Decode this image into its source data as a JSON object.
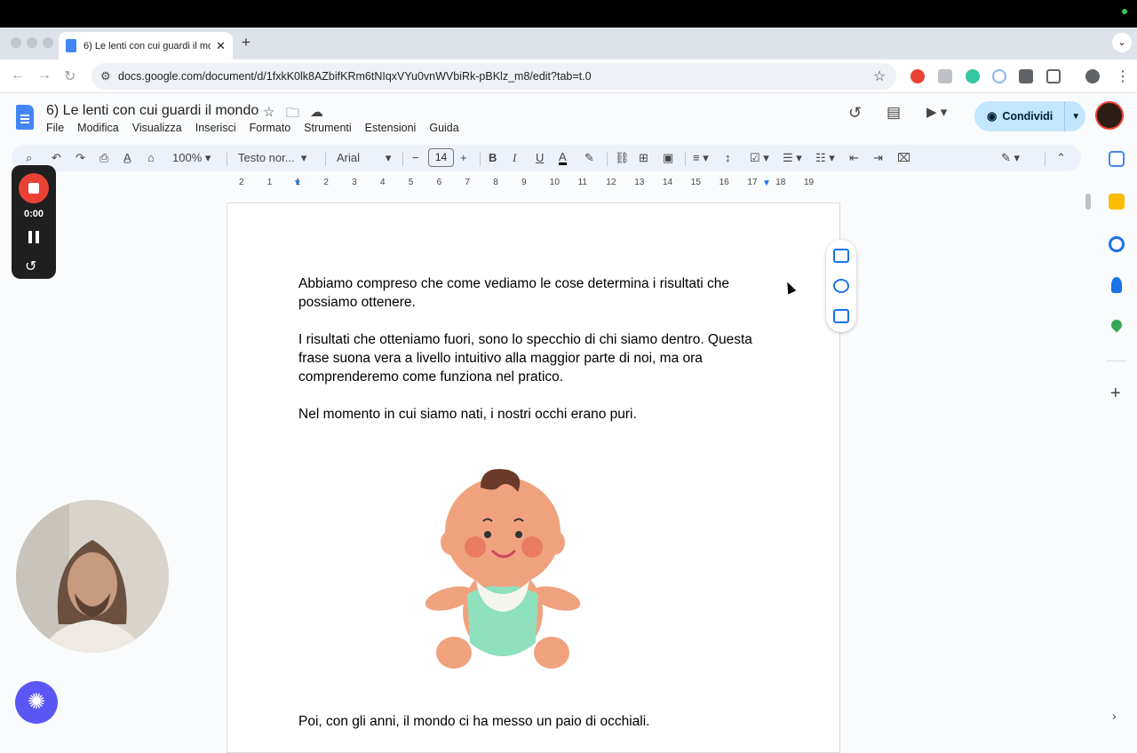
{
  "browser": {
    "tab_title": "6) Le lenti con cui guardi il mo",
    "tab_close": "✕",
    "new_tab": "+",
    "url": "docs.google.com/document/d/1fxkK0lk8AZbifKRm6tNIqxVYu0vnWVbiRk-pBKlz_m8/edit?tab=t.0"
  },
  "doc": {
    "title": "6) Le lenti con cui guardi il mondo",
    "menu": [
      "File",
      "Modifica",
      "Visualizza",
      "Inserisci",
      "Formato",
      "Strumenti",
      "Estensioni",
      "Guida"
    ],
    "share_label": "Condividi"
  },
  "toolbar": {
    "zoom": "100%",
    "style": "Testo nor...",
    "font": "Arial",
    "font_size": "14"
  },
  "ruler": {
    "ticks": [
      "2",
      "1",
      "1",
      "2",
      "3",
      "4",
      "5",
      "6",
      "7",
      "8",
      "9",
      "10",
      "11",
      "12",
      "13",
      "14",
      "15",
      "16",
      "17",
      "18",
      "19"
    ]
  },
  "content": {
    "para1": "Abbiamo compreso che come vediamo le cose determina i risultati che possiamo ottenere.",
    "para2": "I risultati che otteniamo fuori, sono lo specchio di chi siamo dentro. Questa frase suona vera a livello intuitivo alla maggior parte di noi, ma ora comprenderemo come funziona nel pratico.",
    "para3": "Nel momento in cui siamo nati, i nostri occhi erano puri.",
    "para4": "Poi, con gli anni, il mondo ci ha messo un paio di occhiali."
  },
  "recorder": {
    "time": "0:00"
  },
  "colors": {
    "accent": "#1a73e8",
    "share_bg": "#c2e7ff",
    "record_red": "#e94235"
  }
}
